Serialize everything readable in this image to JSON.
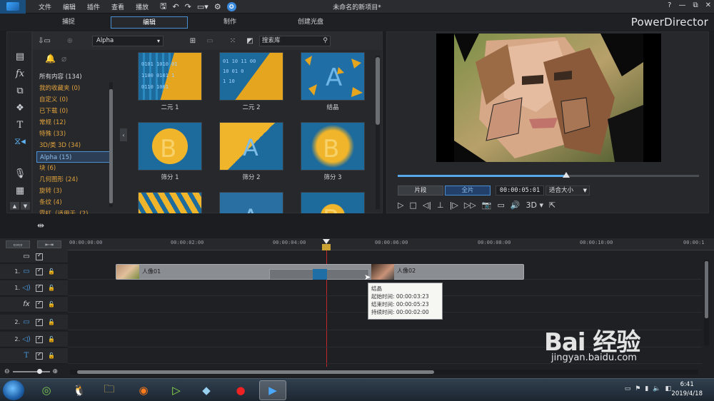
{
  "app": {
    "menu": [
      "文件",
      "编辑",
      "插件",
      "查看",
      "播放"
    ],
    "document_title": "未命名的新项目*",
    "brand": "PowerDirector",
    "window_controls": [
      "?",
      "—",
      "⧉",
      "✕"
    ],
    "colors": {
      "accent": "#4a8fd1",
      "category_text": "#e3a33c",
      "playhead": "#c0282b",
      "clip": "#8a8d92"
    }
  },
  "modes": [
    {
      "label": "捕捉"
    },
    {
      "label": "编辑",
      "active": true
    },
    {
      "label": "制作"
    },
    {
      "label": "创建光盘"
    }
  ],
  "tools": [
    "media-room-icon",
    "fx-icon",
    "pip-icon",
    "particle-icon",
    "title-icon",
    "transition-icon",
    "voice-icon",
    "chapter-icon"
  ],
  "library": {
    "filter_value": "Alpha",
    "search_placeholder": "搜索库",
    "categories": [
      {
        "label": "所有内容 (134)"
      },
      {
        "label": "我的收藏夹 (0)"
      },
      {
        "label": "自定义 (0)"
      },
      {
        "label": "已下载 (0)"
      },
      {
        "label": "常规 (12)"
      },
      {
        "label": "特殊 (33)"
      },
      {
        "label": "3D/类 3D (34)"
      },
      {
        "label": "Alpha (15)",
        "selected": true
      },
      {
        "label": "块 (6)"
      },
      {
        "label": "几何图形 (24)"
      },
      {
        "label": "旋转 (3)"
      },
      {
        "label": "条纹 (4)"
      },
      {
        "label": "霓虹（适用于..(2)"
      }
    ],
    "thumbnails": [
      {
        "label": "二元 1",
        "style": "binary"
      },
      {
        "label": "二元 2",
        "style": "binary2"
      },
      {
        "label": "结晶",
        "style": "crystal"
      },
      {
        "label": "筛分 1",
        "style": "sieve1"
      },
      {
        "label": "筛分 2",
        "style": "sieve2"
      },
      {
        "label": "筛分 3",
        "style": "sieve3"
      },
      {
        "label": "",
        "style": "leaves"
      },
      {
        "label": "",
        "style": "blueA"
      },
      {
        "label": "",
        "style": "yellowB"
      }
    ]
  },
  "preview": {
    "segment_label": "片段",
    "full_label": "全片",
    "timecode": "00:00:05:01",
    "fit_label": "适合大小",
    "progress": 0.56,
    "transport": [
      "▷",
      "□",
      "◁|",
      "⊥",
      "|▷",
      "▷▷",
      "📷",
      "▭",
      "🔊",
      "3D ▾",
      "⇱"
    ]
  },
  "timeline": {
    "ruler": [
      "00:00:00:00",
      "00:00:02:00",
      "00:00:04:00",
      "00:00:06:00",
      "00:00:08:00",
      "00:00:10:00",
      "00:00:1"
    ],
    "tracks": [
      {
        "num": "",
        "icon": "▭",
        "type": "master"
      },
      {
        "num": "1.",
        "icon": "▭",
        "type": "video"
      },
      {
        "num": "1.",
        "icon": "◁)",
        "type": "audio"
      },
      {
        "num": "",
        "icon": "fx",
        "type": "fx"
      },
      {
        "num": "2.",
        "icon": "▭",
        "type": "video"
      },
      {
        "num": "2.",
        "icon": "◁)",
        "type": "audio"
      },
      {
        "num": "",
        "icon": "T",
        "type": "title"
      }
    ],
    "clips": [
      {
        "label": "人像01"
      },
      {
        "label": "人像02"
      }
    ],
    "tooltip": {
      "title": "结晶",
      "start": "起始时间: 00:00:03:23",
      "end": "结束时间: 00:00:05:23",
      "duration": "持续时间:   00:00:02:00"
    }
  },
  "taskbar": {
    "apps": [
      "360-icon",
      "qq-icon",
      "explorer-icon",
      "firefox-icon",
      "media-icon",
      "glass-icon",
      "record-icon",
      "powerdirector-icon"
    ],
    "time": "6:41",
    "date": "2019/4/18"
  },
  "watermark": {
    "main": "Bai 经验",
    "url": "jingyan.baidu.com"
  }
}
